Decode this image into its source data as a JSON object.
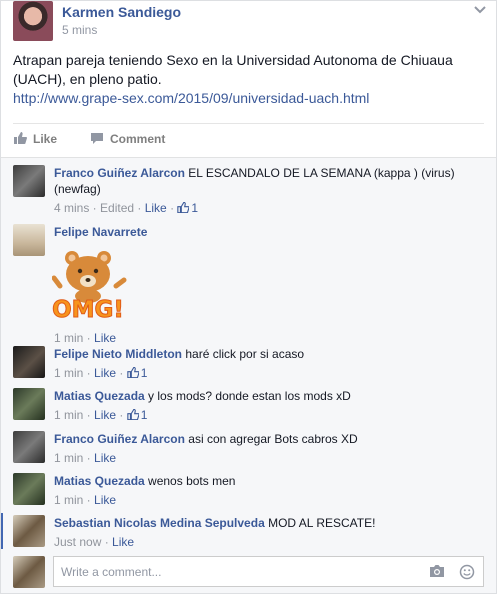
{
  "post": {
    "author": "Karmen Sandiego",
    "time": "5 mins",
    "text": "Atrapan pareja teniendo Sexo en la Universidad Autonoma de Chiuaua (UACH), en pleno patio.",
    "link": "http://www.grape-sex.com/2015/09/universidad-uach.html",
    "menu_icon": "chevron-down-icon"
  },
  "actions": {
    "like_label": "Like",
    "comment_label": "Comment"
  },
  "comments": [
    {
      "name": "Franco Guiñez Alarcon",
      "text": "EL ESCANDALO DE LA SEMANA (kappa ) (virus) (newfag)",
      "time": "4 mins",
      "edited": "Edited",
      "like": "Like",
      "likes": "1"
    },
    {
      "name": "Felipe Navarrete",
      "text": "",
      "sticker_text": "OMG!",
      "time": "1 min",
      "like": "Like"
    },
    {
      "name": "Felipe Nieto Middleton",
      "text": "haré click por si acaso",
      "time": "1 min",
      "like": "Like",
      "likes": "1"
    },
    {
      "name": "Matias Quezada",
      "text": "y los mods? donde estan los mods xD",
      "time": "1 min",
      "like": "Like",
      "likes": "1"
    },
    {
      "name": "Franco Guiñez Alarcon",
      "text": "asi con agregar Bots cabros XD",
      "time": "1 min",
      "like": "Like"
    },
    {
      "name": "Matias Quezada",
      "text": "wenos bots men",
      "time": "1 min",
      "like": "Like"
    },
    {
      "name": "Sebastian Nicolas Medina Sepulveda",
      "text": "MOD AL RESCATE!",
      "time": "Just now",
      "like": "Like"
    }
  ],
  "composer": {
    "placeholder": "Write a comment...",
    "icons": [
      "camera-icon",
      "emoji-icon"
    ]
  },
  "colors": {
    "link": "#3b5998",
    "meta": "#90949c",
    "comments_bg": "#f6f7f9",
    "accent": "#4267b2"
  }
}
